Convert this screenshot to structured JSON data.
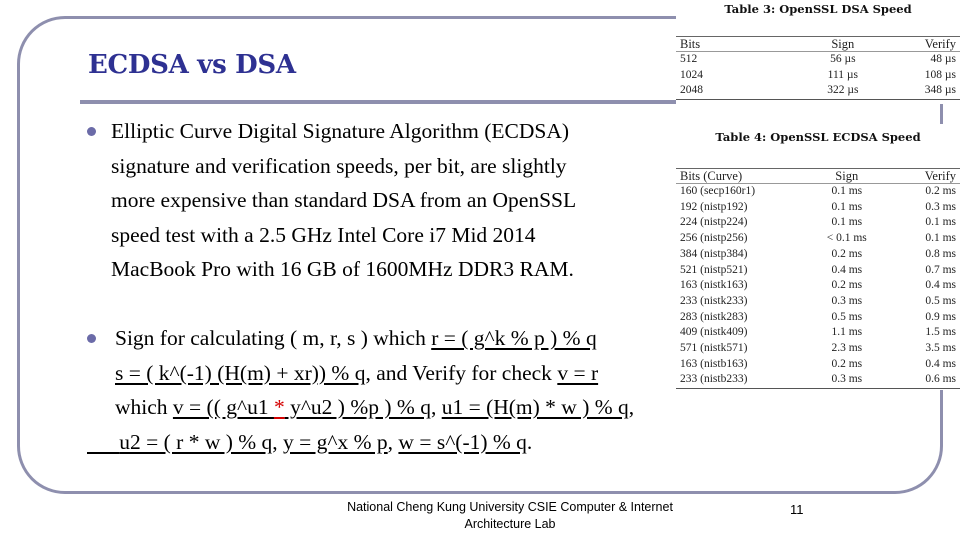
{
  "slide": {
    "title": "ECDSA vs DSA",
    "bullets": [
      {
        "lines": [
          " Elliptic Curve Digital Signature Algorithm (ECDSA)",
          "signature and verification speeds, per bit, are slightly",
          "more expensive than standard DSA from an OpenSSL",
          "speed test with a 2.5 GHz Intel Core i7 Mid 2014",
          "MacBook Pro with 16 GB of 1600MHz DDR3 RAM."
        ]
      },
      {
        "l1_a": "Sign for calculating ( m, r, s ) which ",
        "l1_u": "r = ( g^k % p ) % q",
        "l2_u": "s = ( k^(-1) (H(m) + xr)) % q",
        "l2_b": ", and Verify for check ",
        "l2_u2": "v = r",
        "l3_a": "which ",
        "l3_u1": "v = (( g^u1 ",
        "l3_star": "*",
        "l3_u2": " y^u2 ) %p ) % q",
        "l3_sep": ", ",
        "l3_u3": "u1 = (H(m) * w ) % q",
        "l3_end": ",",
        "l4_u1": "u2 = ( r * w ) % q",
        "l4_sep1": ", ",
        "l4_u2": "y = g^x % p",
        "l4_sep2": ", ",
        "l4_u3": "w = s^(-1) % q",
        "l4_end": "."
      }
    ],
    "footer": {
      "line1": "National Cheng Kung University CSIE Computer & Internet",
      "line2": "Architecture Lab",
      "page_number": "11"
    }
  },
  "tables": {
    "dsa": {
      "caption": "Table 3: OpenSSL DSA Speed",
      "headers": [
        "Bits",
        "Sign",
        "Verify"
      ],
      "rows": [
        [
          "512",
          "56 µs",
          "48 µs"
        ],
        [
          "1024",
          "111 µs",
          "108 µs"
        ],
        [
          "2048",
          "322 µs",
          "348 µs"
        ]
      ]
    },
    "ecdsa": {
      "caption": "Table 4: OpenSSL ECDSA Speed",
      "headers": [
        "Bits (Curve)",
        "Sign",
        "Verify"
      ],
      "rows": [
        [
          "160 (secp160r1)",
          "0.1 ms",
          "0.2 ms"
        ],
        [
          "192 (nistp192)",
          "0.1 ms",
          "0.3 ms"
        ],
        [
          "224 (nistp224)",
          "0.1 ms",
          "0.1 ms"
        ],
        [
          "256 (nistp256)",
          "< 0.1 ms",
          "0.1 ms"
        ],
        [
          "384 (nistp384)",
          "0.2 ms",
          "0.8 ms"
        ],
        [
          "521 (nistp521)",
          "0.4 ms",
          "0.7 ms"
        ],
        [
          "163 (nistk163)",
          "0.2 ms",
          "0.4 ms"
        ],
        [
          "233 (nistk233)",
          "0.3 ms",
          "0.5 ms"
        ],
        [
          "283 (nistk283)",
          "0.5 ms",
          "0.9 ms"
        ],
        [
          "409 (nistk409)",
          "1.1 ms",
          "1.5 ms"
        ],
        [
          "571 (nistk571)",
          "2.3 ms",
          "3.5 ms"
        ],
        [
          "163 (nistb163)",
          "0.2 ms",
          "0.4 ms"
        ],
        [
          "233 (nistb233)",
          "0.3 ms",
          "0.6 ms"
        ]
      ]
    }
  },
  "colors": {
    "title": "#2e3192",
    "frame": "#8e8fae",
    "bullet": "#6b6ba8",
    "highlight_star": "#d40000"
  }
}
